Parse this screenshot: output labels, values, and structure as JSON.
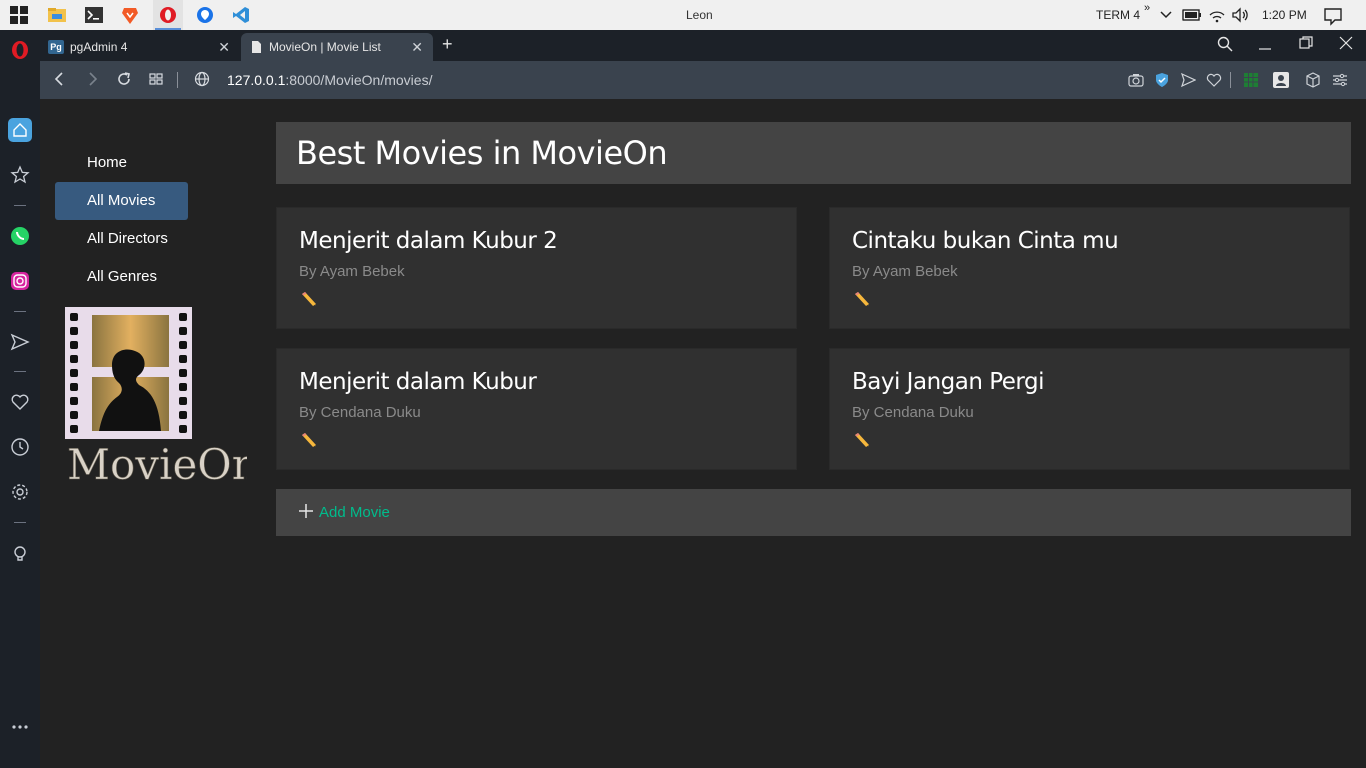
{
  "taskbar": {
    "window_title": "Leon",
    "tray_label": "TERM 4",
    "clock": "1:20 PM"
  },
  "tabs": [
    {
      "label": "pgAdmin 4",
      "favicon": "Pg"
    },
    {
      "label": "MovieOn | Movie List"
    }
  ],
  "address": {
    "host": "127.0.0.1",
    "path": ":8000/MovieOn/movies/"
  },
  "nav": {
    "items": [
      {
        "label": "Home"
      },
      {
        "label": "All Movies"
      },
      {
        "label": "All Directors"
      },
      {
        "label": "All Genres"
      }
    ],
    "active_index": 1
  },
  "logo": {
    "text": "MovieOn"
  },
  "header": {
    "title": "Best Movies in MovieOn"
  },
  "movies": [
    {
      "title": "Menjerit dalam Kubur 2",
      "director": "By Ayam Bebek"
    },
    {
      "title": "Cintaku bukan Cinta mu",
      "director": "By Ayam Bebek"
    },
    {
      "title": "Menjerit dalam Kubur",
      "director": "By Cendana Duku"
    },
    {
      "title": "Bayi Jangan Pergi",
      "director": "By Cendana Duku"
    }
  ],
  "add_movie": {
    "label": "Add Movie"
  },
  "colors": {
    "accent_green": "#00bc8c",
    "nav_active": "#375a7f",
    "card_bg": "#303030",
    "header_bg": "#444444"
  }
}
